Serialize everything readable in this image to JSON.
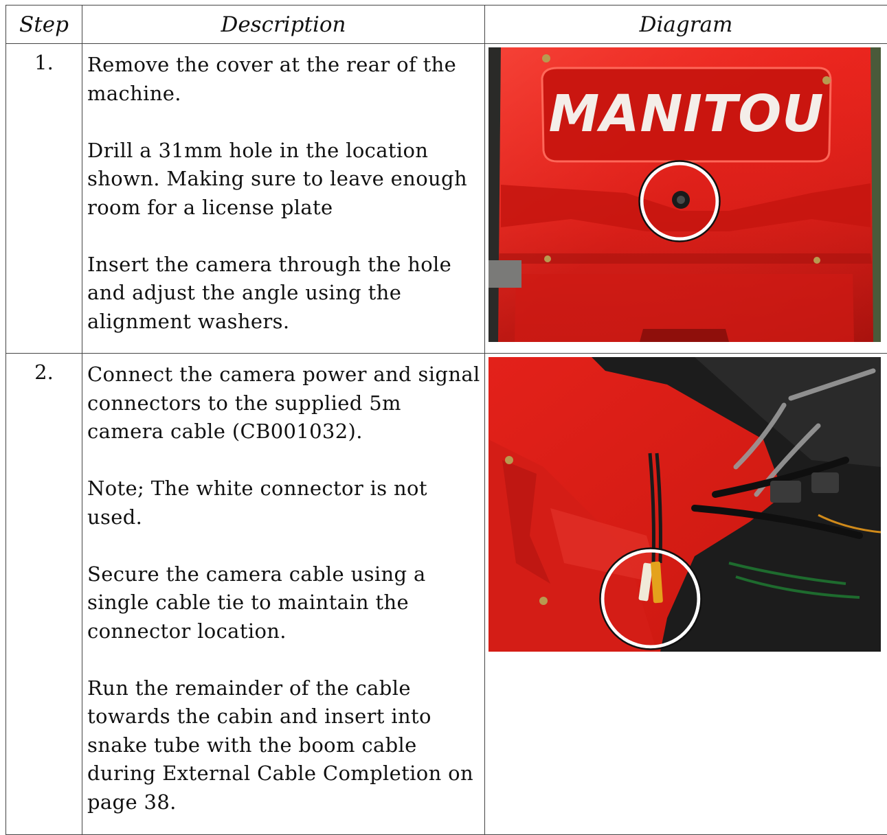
{
  "table": {
    "headers": {
      "step": "Step",
      "description": "Description",
      "diagram": "Diagram"
    },
    "rows": [
      {
        "step": "1.",
        "paragraphs": [
          "Remove the cover at the rear of the machine.",
          "Drill a 31mm hole in the location shown. Making sure to leave enough room for a license plate",
          "Insert the camera through the hole and adjust the angle using the alignment washers."
        ],
        "photo": {
          "brand_text": "MANITOU",
          "subject": "rear cover with camera hole circled"
        }
      },
      {
        "step": "2.",
        "paragraphs": [
          "Connect the camera power and signal connectors to the supplied 5m camera cable (CB001032).",
          "Note; The white connector is not used.",
          "Secure the camera cable using a single cable tie to maintain the connector location.",
          "Run the remainder of the cable towards the cabin and insert into snake tube with the boom cable during External Cable Completion on page 38."
        ],
        "photo": {
          "subject": "camera connectors circled inside engine bay"
        }
      }
    ]
  },
  "colors": {
    "machine_red": "#d8201a",
    "highlight_ring": "#ffffff",
    "border": "#444444"
  }
}
